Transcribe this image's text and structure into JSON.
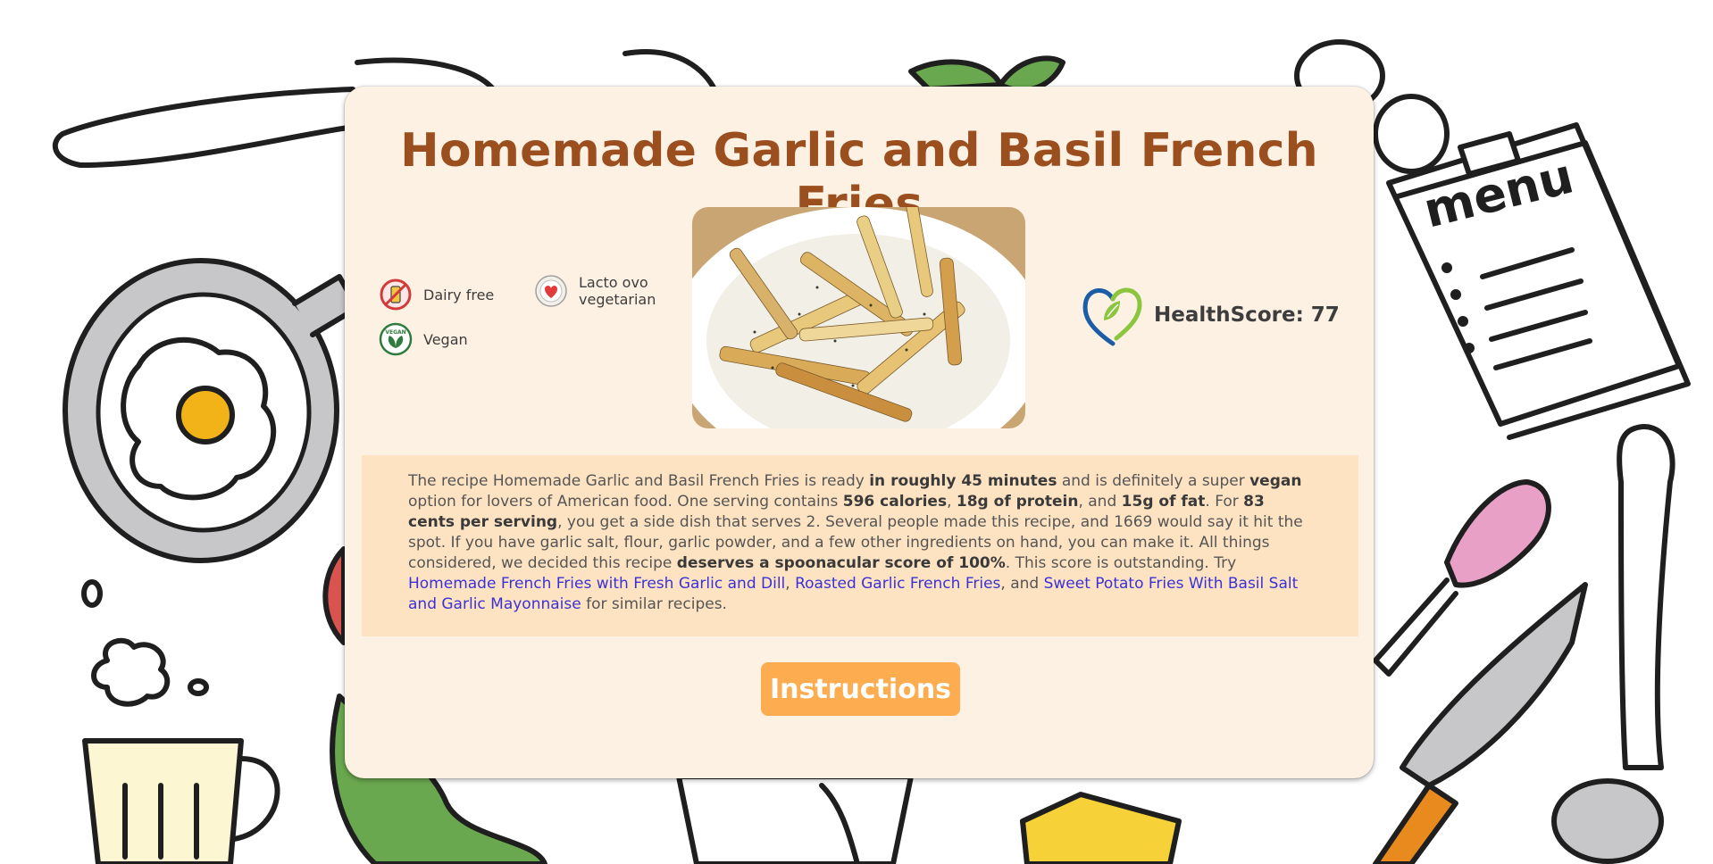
{
  "recipe": {
    "title": "Homemade Garlic and Basil French Fries",
    "photo_alt": "French fries on a white plate"
  },
  "badges": [
    {
      "icon": "dairy-free-icon",
      "label": "Dairy free"
    },
    {
      "icon": "lacto-ovo-vegetarian-icon",
      "label_line1": "Lacto ovo",
      "label_line2": "vegetarian"
    },
    {
      "icon": "vegan-icon",
      "label": "Vegan",
      "icon_text": "VEGAN"
    }
  ],
  "health": {
    "label": "HealthScore: 77",
    "icon": "heart-leaf-icon"
  },
  "summary": {
    "t1": "The recipe Homemade Garlic and Basil French Fries is ready ",
    "b1": "in roughly 45 minutes",
    "t2": " and is definitely a super ",
    "b2": "vegan",
    "t3": " option for lovers of American food. One serving contains ",
    "b3": "596 calories",
    "t4": ", ",
    "b4": "18g of protein",
    "t5": ", and ",
    "b5": "15g of fat",
    "t6": ". For ",
    "b6": "83 cents per serving",
    "t7": ", you get a side dish that serves 2. Several people made this recipe, and 1669 would say it hit the spot. If you have garlic salt, flour, garlic powder, and a few other ingredients on hand, you can make it. All things considered, we decided this recipe ",
    "b7": "deserves a spoonacular score of 100%",
    "t8": ". This score is outstanding. Try ",
    "l1": "Homemade French Fries with Fresh Garlic and Dill",
    "t9": ", ",
    "l2": "Roasted Garlic French Fries",
    "t10": ", and ",
    "l3": "Sweet Potato Fries With Basil Salt and Garlic Mayonnaise",
    "t11": " for similar recipes."
  },
  "instructions_button": "Instructions",
  "background": {
    "menu_text": "menu"
  },
  "colors": {
    "title": "#9b4f1f",
    "card": "#fdf1e4",
    "summary_bg": "#fde3c2",
    "link": "#3a32d6",
    "button": "#fdac4f"
  }
}
